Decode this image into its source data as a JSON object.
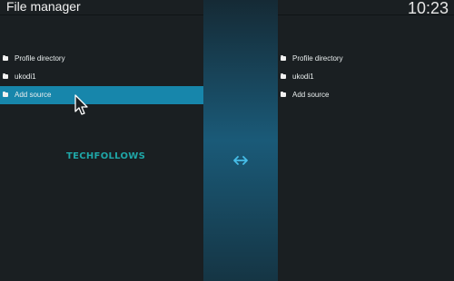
{
  "window": {
    "title": "File manager",
    "clock": "10:23"
  },
  "left_pane": {
    "items": [
      {
        "label": "Profile directory",
        "icon": "folder-icon"
      },
      {
        "label": "ukodi1",
        "icon": "folder-icon"
      },
      {
        "label": "Add source",
        "icon": "folder-icon",
        "selected": true
      }
    ]
  },
  "right_pane": {
    "items": [
      {
        "label": "Profile directory",
        "icon": "folder-icon"
      },
      {
        "label": "ukodi1",
        "icon": "folder-icon"
      },
      {
        "label": "Add source",
        "icon": "folder-icon"
      }
    ]
  },
  "center": {
    "icon": "swap-arrows-icon"
  },
  "watermark": {
    "text": "TECHFOLLOWS"
  },
  "colors": {
    "background": "#1a1f22",
    "selection": "#1786ab",
    "accent": "#46bde8",
    "watermark": "#1fa6a7"
  }
}
